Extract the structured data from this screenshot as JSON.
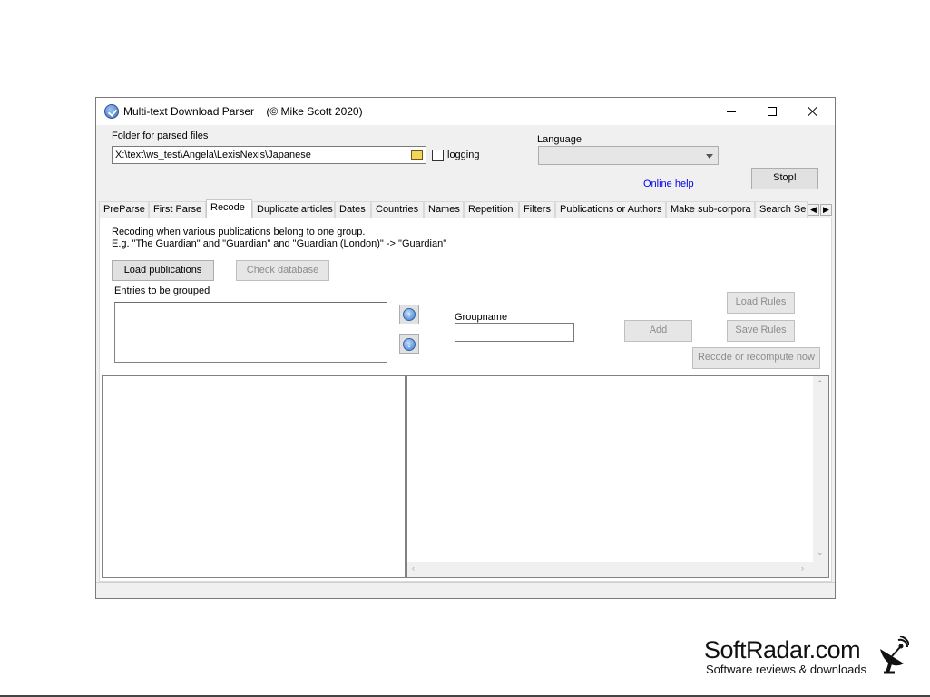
{
  "window": {
    "title": "Multi-text Download Parser    (© Mike Scott 2020)"
  },
  "top": {
    "folder_label": "Folder for parsed files",
    "folder_value": "X:\\text\\ws_test\\Angela\\LexisNexis\\Japanese",
    "logging_label": "logging",
    "logging_checked": false,
    "language_label": "Language",
    "language_value": "",
    "online_help": "Online help",
    "stop_button": "Stop!"
  },
  "tabs": [
    {
      "label": "PreParse"
    },
    {
      "label": "First Parse"
    },
    {
      "label": "Recode"
    },
    {
      "label": "Duplicate articles"
    },
    {
      "label": "Dates"
    },
    {
      "label": "Countries"
    },
    {
      "label": "Names"
    },
    {
      "label": "Repetition"
    },
    {
      "label": "Filters"
    },
    {
      "label": "Publications or Authors"
    },
    {
      "label": "Make sub-corpora"
    },
    {
      "label": "Search Se"
    }
  ],
  "active_tab": "Recode",
  "recode": {
    "description_line1": "Recoding when various publications belong to one group.",
    "description_line2": "E.g. \"The Guardian\" and \"Guardian\" and \"Guardian (London)\" -> \"Guardian\"",
    "load_publications": "Load publications",
    "check_database": "Check database",
    "entries_label": "Entries to be grouped",
    "groupname_label": "Groupname",
    "groupname_value": "",
    "add_button": "Add",
    "load_rules": "Load Rules",
    "save_rules": "Save Rules",
    "recode_now": "Recode or recompute now"
  },
  "watermark": {
    "name": "SoftRadar.com",
    "tagline": "Software reviews & downloads"
  },
  "colors": {
    "link": "#0000ee",
    "window_bg": "#f0f0f0",
    "disabled_text": "#8c8c8c"
  },
  "icons": [
    "app-icon",
    "minimize-icon",
    "maximize-icon",
    "close-icon",
    "folder-icon",
    "arrow-up-icon",
    "arrow-down-icon",
    "radar-dish-icon"
  ]
}
